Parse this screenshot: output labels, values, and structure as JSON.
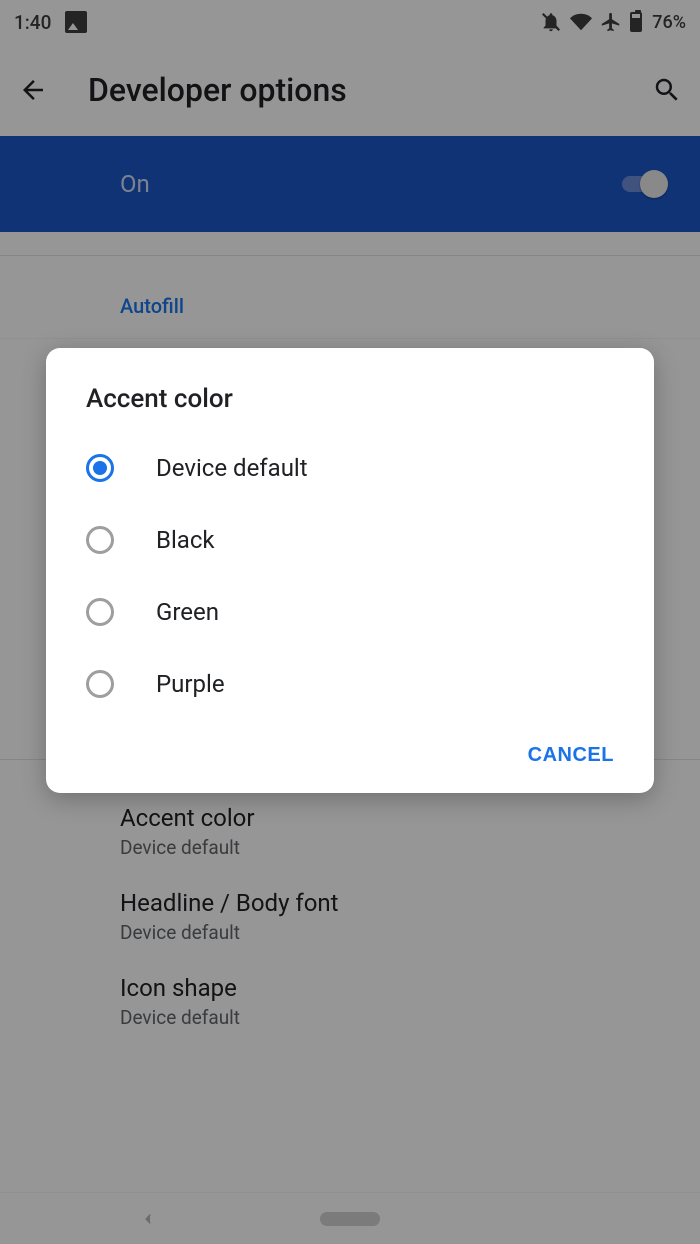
{
  "status": {
    "time": "1:40",
    "battery_pct": "76%"
  },
  "appbar": {
    "title": "Developer options"
  },
  "switch_panel": {
    "label": "On",
    "state": "on"
  },
  "sections": {
    "autofill_header": "Autofill"
  },
  "settings": [
    {
      "title": "Accent color",
      "sub": "Device default"
    },
    {
      "title": "Headline / Body font",
      "sub": "Device default"
    },
    {
      "title": "Icon shape",
      "sub": "Device default"
    }
  ],
  "dialog": {
    "title": "Accent color",
    "options": [
      {
        "label": "Device default",
        "selected": true
      },
      {
        "label": "Black",
        "selected": false
      },
      {
        "label": "Green",
        "selected": false
      },
      {
        "label": "Purple",
        "selected": false
      }
    ],
    "cancel": "CANCEL"
  }
}
